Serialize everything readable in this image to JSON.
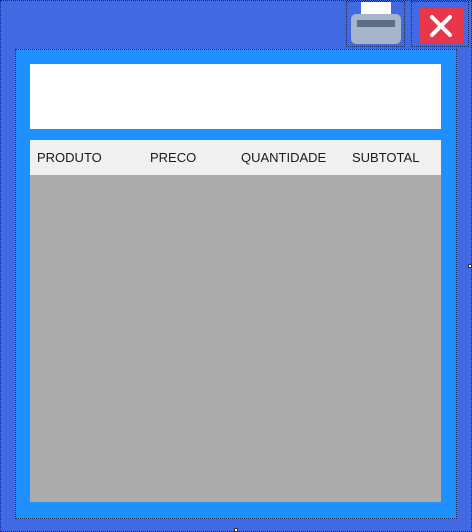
{
  "toolbar": {
    "print_icon": "printer-icon",
    "close_icon": "close-icon",
    "close_color": "#e8364a"
  },
  "colors": {
    "window_background": "#4169e1",
    "panel_background": "#1e90ff",
    "grid_background": "#ababab",
    "header_background": "#f0f0f0"
  },
  "table": {
    "columns": [
      "PRODUTO",
      "PRECO",
      "QUANTIDADE",
      "SUBTOTAL"
    ],
    "rows": []
  }
}
